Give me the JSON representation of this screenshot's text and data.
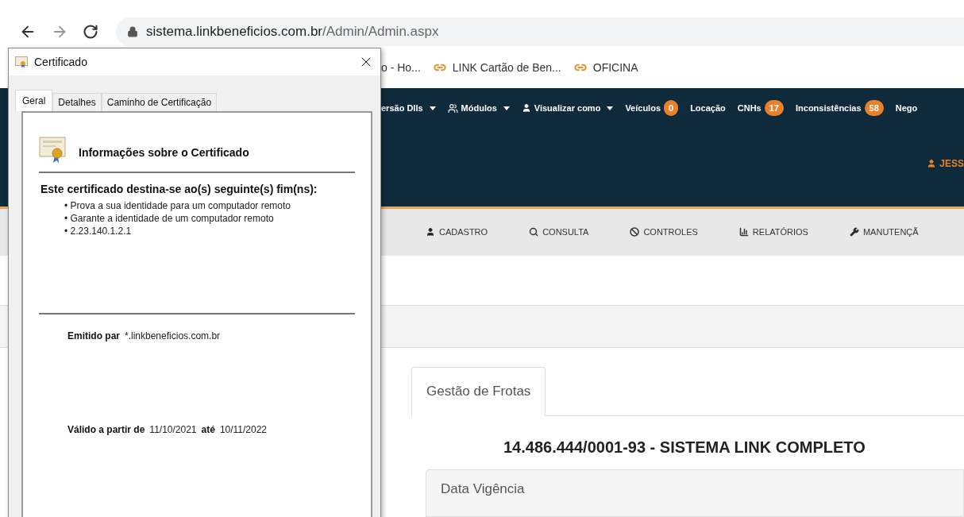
{
  "browser": {
    "url": {
      "host": "sistema.linkbeneficios.com.br",
      "path": "/Admin/Admin.aspx"
    }
  },
  "bookmarks": [
    {
      "label": "o - Ho...",
      "kind": "plain"
    },
    {
      "label": "LINK Cartão de Ben...",
      "kind": "link"
    },
    {
      "label": "OFICINA",
      "kind": "link"
    }
  ],
  "navbar": {
    "items": [
      {
        "label": "ersão Dlls",
        "dropdown": true
      },
      {
        "label": "Módulos",
        "dropdown": true
      },
      {
        "label": "Visualizar como",
        "dropdown": true
      },
      {
        "label": "Veículos",
        "dropdown": false,
        "badge": "0"
      },
      {
        "label": "Locação",
        "dropdown": false
      },
      {
        "label": "CNHs",
        "dropdown": false,
        "badge": "17"
      },
      {
        "label": "Inconsistências",
        "dropdown": false,
        "badge": "58"
      },
      {
        "label": "Nego",
        "dropdown": false
      }
    ],
    "user": "JESS"
  },
  "menu": [
    {
      "label": "CADASTRO"
    },
    {
      "label": "CONSULTA"
    },
    {
      "label": "CONTROLES"
    },
    {
      "label": "RELATÓRIOS"
    },
    {
      "label": "MANUTENÇÃ"
    }
  ],
  "content": {
    "tabs": [
      {
        "label": "Gestão de Frotas",
        "selected": true
      }
    ],
    "title": "14.486.444/0001-93 - SISTEMA LINK COMPLETO",
    "panel": {
      "title": "Data Vigência"
    }
  },
  "dialog": {
    "title": "Certificado",
    "tabs": [
      {
        "label": "Geral",
        "selected": true
      },
      {
        "label": "Detalhes",
        "selected": false
      },
      {
        "label": "Caminho de Certificação",
        "selected": false
      }
    ],
    "heading": "Informações sobre o Certificado",
    "purpose_title": "Este certificado destina-se ao(s) seguinte(s) fim(ns):",
    "purposes": [
      "• Prova a sua identidade para um computador remoto",
      "• Garante a identidade de um computador remoto",
      "• 2.23.140.1.2.1"
    ],
    "issued_to": {
      "label": "Emitido par",
      "value": "*.linkbeneficios.com.br"
    },
    "validity": {
      "from_label": "Válido a partir de",
      "from": "11/10/2021",
      "to_label": "até",
      "to": "10/11/2022"
    }
  }
}
